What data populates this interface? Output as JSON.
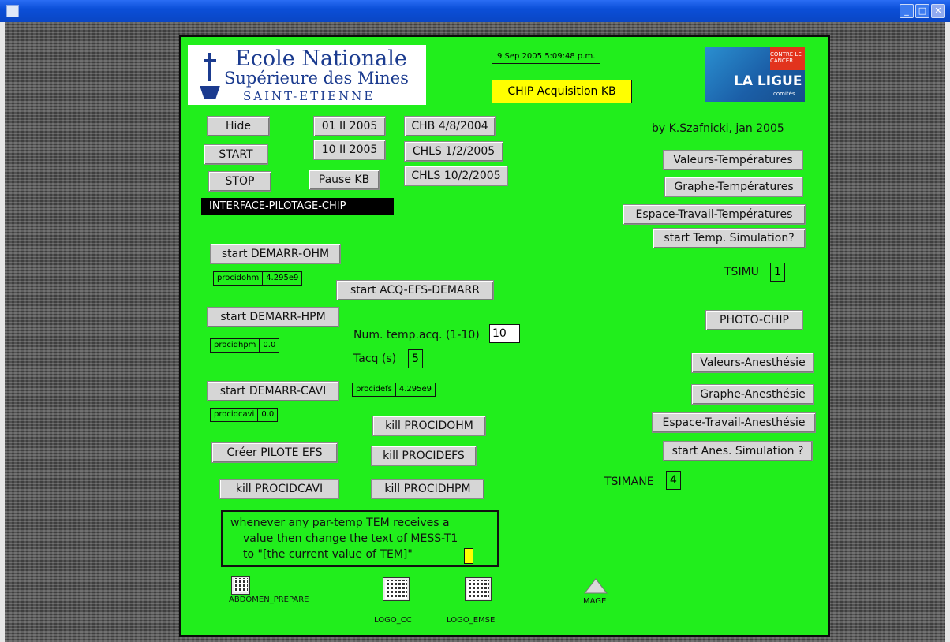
{
  "window": {
    "min_icon": "_",
    "max_icon": "□",
    "close_icon": "✕"
  },
  "header": {
    "school_line1": "Ecole Nationale",
    "school_line2": "Supérieure des Mines",
    "school_line3": "SAINT-ETIENNE",
    "datetime": "9 Sep 2005  5:09:48 p.m.",
    "app_title": "CHIP Acquisition KB",
    "ligue_small": "CONTRE LE CANCER",
    "ligue_big": "LA LIGUE",
    "ligue_sub": "comités",
    "author": "by K.Szafnicki, jan 2005",
    "interface_title": "INTERFACE-PILOTAGE-CHIP"
  },
  "buttons": {
    "hide": "Hide",
    "start": "START",
    "stop": "STOP",
    "d1": "01 II 2005",
    "d2": "10 II 2005",
    "pause": "Pause KB",
    "chb": "CHB 4/8/2004",
    "chls1": "CHLS 1/2/2005",
    "chls2": "CHLS 10/2/2005",
    "val_temp": "Valeurs-Températures",
    "graph_temp": "Graphe-Températures",
    "espace_temp": "Espace-Travail-Températures",
    "start_temp_sim": "start Temp. Simulation?",
    "start_ohm": "start DEMARR-OHM",
    "start_acq": "start ACQ-EFS-DEMARR",
    "start_hpm": "start DEMARR-HPM",
    "start_cavi": "start DEMARR-CAVI",
    "photo": "PHOTO-CHIP",
    "val_anes": "Valeurs-Anesthésie",
    "graph_anes": "Graphe-Anesthésie",
    "espace_anes": "Espace-Travail-Anesthésie",
    "start_anes_sim": "start Anes. Simulation ?",
    "kill_ohm": "kill PROCIDOHM",
    "kill_efs": "kill PROCIDEFS",
    "kill_hpm": "kill PROCIDHPM",
    "kill_cavi": "kill PROCIDCAVI",
    "creer": "Créer PILOTE EFS"
  },
  "fields": {
    "tsimu_label": "TSIMU",
    "tsimu_value": "1",
    "tsimane_label": "TSIMANE",
    "tsimane_value": "4",
    "numtemp_label": "Num. temp.acq. (1-10)",
    "numtemp_value": "10",
    "tacq_label": "Tacq (s)",
    "tacq_value": "5"
  },
  "procs": {
    "ohm": {
      "name": "procidohm",
      "value": "4.295e9"
    },
    "hpm": {
      "name": "procidhpm",
      "value": "0.0"
    },
    "efs": {
      "name": "procidefs",
      "value": "4.295e9"
    },
    "cavi": {
      "name": "procidcavi",
      "value": "0.0"
    }
  },
  "script_text": {
    "line1": "whenever any par-temp TEM receives a",
    "line2": "value then change the text of MESS-T1",
    "line3": "to \"[the current value of TEM]\""
  },
  "icons": {
    "abdomen": "ABDOMEN_PREPARE",
    "logo_cc": "LOGO_CC",
    "logo_emse": "LOGO_EMSE",
    "image": "IMAGE"
  },
  "colors": {
    "stage": "#21ee1c",
    "title_box": "#ffff00",
    "label_dark": "#000000"
  }
}
